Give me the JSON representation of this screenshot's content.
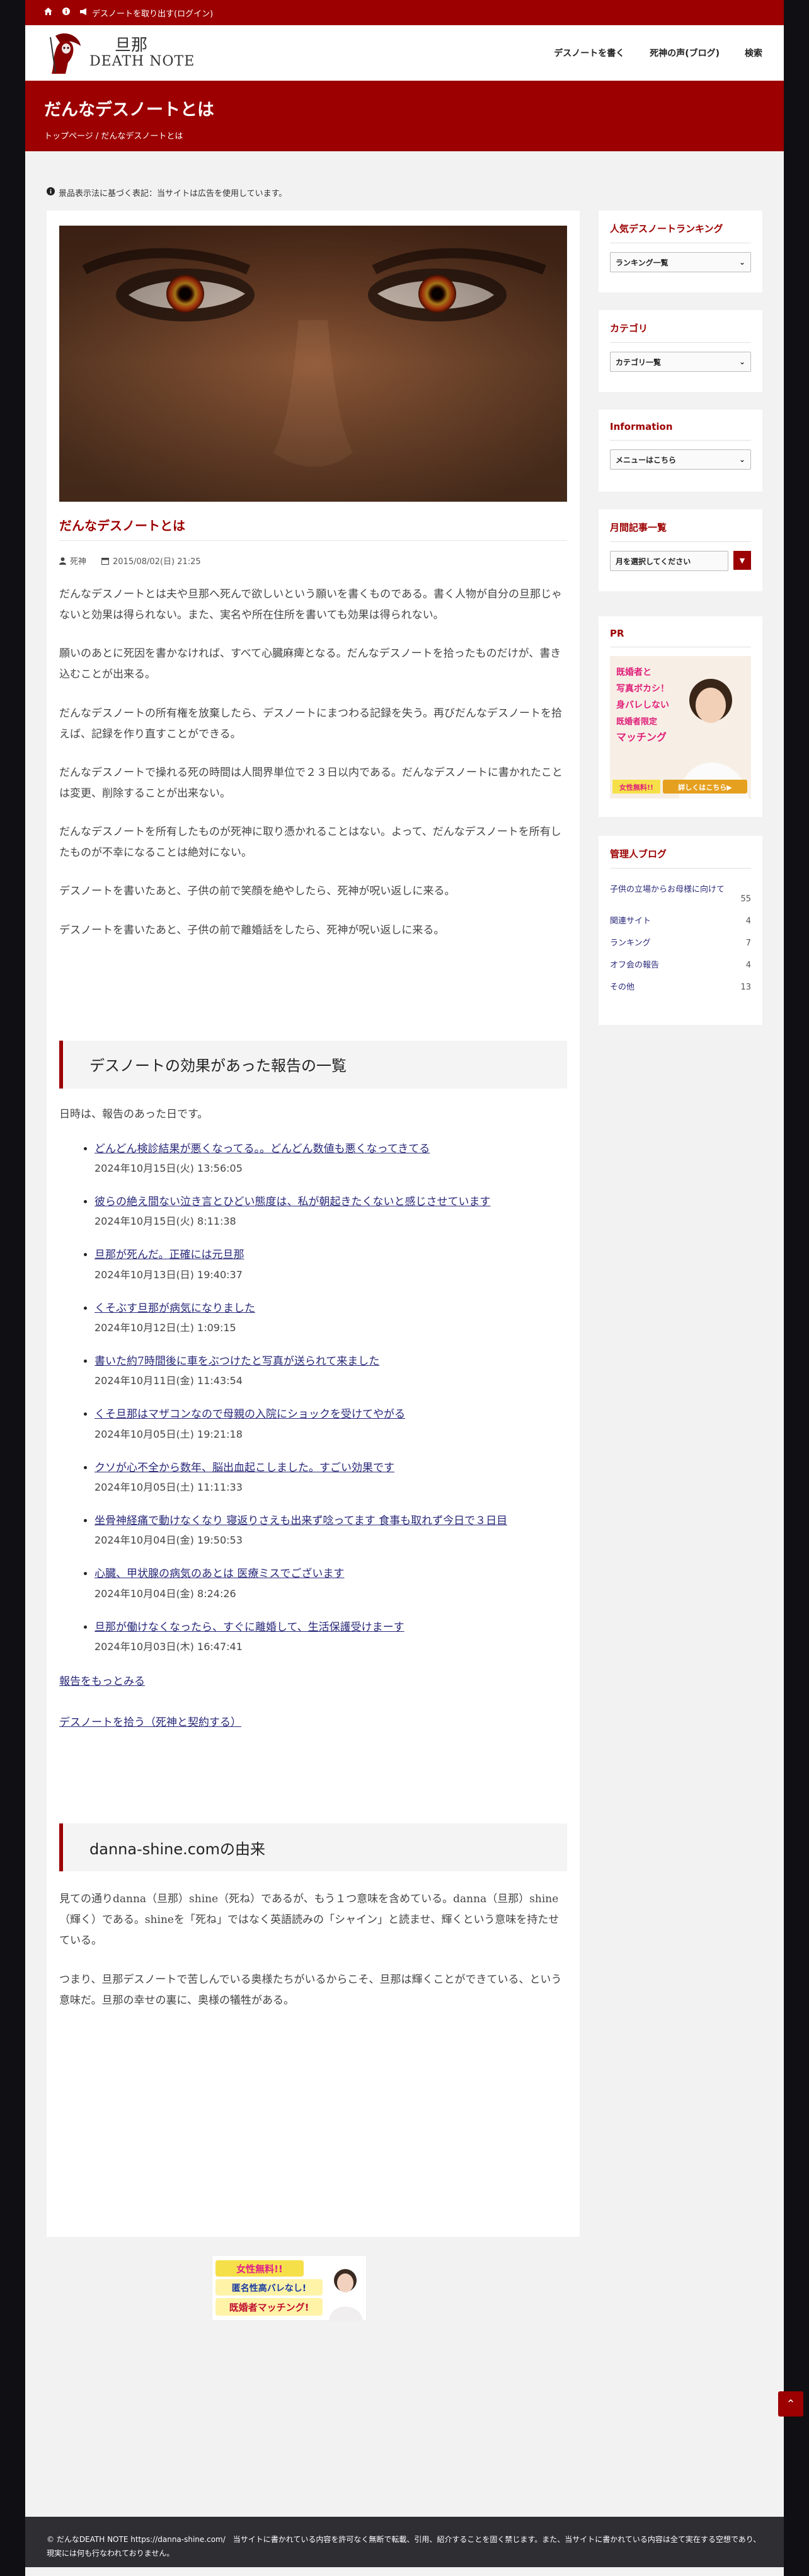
{
  "topbar": {
    "home_icon": "home-icon",
    "info_icon": "info-icon",
    "announce": "デスノートを取り出す(ログイン)"
  },
  "site": {
    "logo_line1": "旦那",
    "logo_line2": "DEATH NOTE"
  },
  "nav": [
    "デスノートを書く",
    "死神の声(ブログ)",
    "検索"
  ],
  "banner": {
    "title": "だんなデスノートとは",
    "crumb_home": "トップページ",
    "crumb_sep": "/",
    "crumb_current": "だんなデスノートとは"
  },
  "notice": "景品表示法に基づく表記：当サイトは広告を使用しています。",
  "article": {
    "title": "だんなデスノートとは",
    "author": "死神",
    "date": "2015/08/02(日) 21:25",
    "paragraphs": [
      "だんなデスノートとは夫や旦那へ死んで欲しいという願いを書くものである。書く人物が自分の旦那じゃないと効果は得られない。また、実名や所在住所を書いても効果は得られない。",
      "願いのあとに死因を書かなければ、すべて心臓麻痺となる。だんなデスノートを拾ったものだけが、書き込むことが出来る。",
      "だんなデスノートの所有権を放棄したら、デスノートにまつわる記録を失う。再びだんなデスノートを拾えば、記録を作り直すことができる。",
      "だんなデスノートで操れる死の時間は人間界単位で２３日以内である。だんなデスノートに書かれたことは変更、削除することが出来ない。",
      "だんなデスノートを所有したものが死神に取り憑かれることはない。よって、だんなデスノートを所有したものが不幸になることは絶対にない。",
      "デスノートを書いたあと、子供の前で笑顔を絶やしたら、死神が呪い返しに来る。",
      "デスノートを書いたあと、子供の前で離婚話をしたら、死神が呪い返しに来る。"
    ]
  },
  "reports": {
    "heading": "デスノートの効果があった報告の一覧",
    "lead": "日時は、報告のあった日です。",
    "items": [
      {
        "text": "どんどん検診結果が悪くなってる。。どんどん数値も悪くなってきてる",
        "date": "2024年10月15日(火) 13:56:05"
      },
      {
        "text": "彼らの絶え間ない泣き言とひどい態度は、私が朝起きたくないと感じさせています",
        "date": "2024年10月15日(火) 8:11:38"
      },
      {
        "text": "旦那が死んだ。正確には元旦那",
        "date": "2024年10月13日(日) 19:40:37"
      },
      {
        "text": "くそぶす旦那が病気になりました",
        "date": "2024年10月12日(土) 1:09:15"
      },
      {
        "text": "書いた約7時間後に車をぶつけたと写真が送られて来ました",
        "date": "2024年10月11日(金) 11:43:54"
      },
      {
        "text": "くそ旦那はマザコンなので母親の入院にショックを受けてやがる",
        "date": "2024年10月05日(土) 19:21:18"
      },
      {
        "text": "クソが心不全から数年、脳出血起こしました。すごい効果です",
        "date": "2024年10月05日(土) 11:11:33"
      },
      {
        "text": "坐骨神経痛で動けなくなり 寝返りさえも出来ず唸ってます 食事も取れず今日で３日目",
        "date": "2024年10月04日(金) 19:50:53"
      },
      {
        "text": "心臓、甲状腺の病気のあとは 医療ミスでございます",
        "date": "2024年10月04日(金) 8:24:26"
      },
      {
        "text": "旦那が働けなくなったら、すぐに離婚して、生活保護受けまーす",
        "date": "2024年10月03日(木) 16:47:41"
      }
    ],
    "more_link": "報告をもっとみる",
    "pick_link": "デスノートを拾う（死神と契約する）"
  },
  "origin": {
    "heading": "danna-shine.comの由来",
    "paragraphs": [
      "見ての通りdanna（旦那）shine（死ね）であるが、もう１つ意味を含めている。danna（旦那）shine（輝く）である。shineを「死ね」ではなく英語読みの「シャイン」と読ませ、輝くという意味を持たせている。",
      "つまり、旦那デスノートで苦しんでいる奥様たちがいるからこそ、旦那は輝くことができている、という意味だ。旦那の幸せの裏に、奥様の犠牲がある。"
    ]
  },
  "ad_banner": {
    "line1": "女性無料!!",
    "line2": "匿名性高バレなし!",
    "line3": "既婚者マッチング!"
  },
  "sidebar": {
    "ranking": {
      "title": "人気デスノートランキング",
      "select": "ランキング一覧"
    },
    "category": {
      "title": "カテゴリ",
      "select": "カテゴリ一覧"
    },
    "information": {
      "title": "Information",
      "select": "メニューはこちら"
    },
    "monthly": {
      "title": "月間記事一覧",
      "select": "月を選択してください"
    },
    "pr": {
      "title": "PR",
      "line1": "既婚者と",
      "line2": "写真ボカシ！",
      "line3": "身バレしない",
      "line4": "既婚者限定",
      "line5": "マッチング",
      "badge": "女性無料!!",
      "button": "詳しくはこちら▶"
    },
    "blog": {
      "title": "管理人ブログ",
      "items": [
        {
          "label": "子供の立場からお母様に向けて",
          "count": "55"
        },
        {
          "label": "関連サイト",
          "count": "4"
        },
        {
          "label": "ランキング",
          "count": "7"
        },
        {
          "label": "オフ会の報告",
          "count": "4"
        },
        {
          "label": "その他",
          "count": "13"
        }
      ]
    }
  },
  "footer": {
    "text": "© だんなDEATH NOTE https://danna-shine.com/　当サイトに書かれている内容を許可なく無断で転載、引用、紹介することを固く禁じます。また、当サイトに書かれている内容は全て実在する空想であり、現実には何も行なわれておりません。"
  },
  "colors": {
    "accent": "#9c0000",
    "link": "#29297a"
  }
}
